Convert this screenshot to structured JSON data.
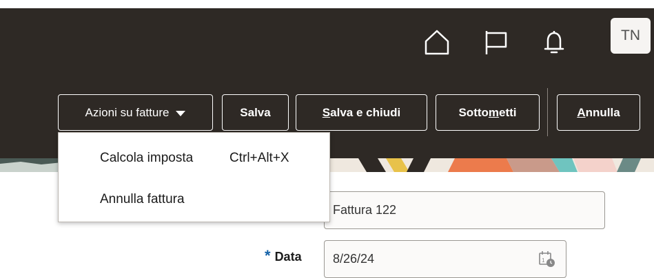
{
  "header": {
    "avatar_initials": "TN",
    "icons": [
      "home-icon",
      "flag-icon",
      "bell-icon"
    ]
  },
  "toolbar": {
    "actions_label": "Azioni su fatture",
    "save_label": "Salva",
    "save_close_prefix": "",
    "save_close_access": "S",
    "save_close_rest": "alva e chiudi",
    "submit_prefix": "Sotto",
    "submit_access": "m",
    "submit_rest": "etti",
    "cancel_prefix": "",
    "cancel_access": "A",
    "cancel_rest": "nnulla"
  },
  "menu": {
    "items": [
      {
        "label": "Calcola imposta",
        "shortcut": "Ctrl+Alt+X"
      },
      {
        "label": "Annulla fattura",
        "shortcut": ""
      }
    ]
  },
  "form": {
    "description_value": "Fattura 122",
    "date_label": "Data",
    "date_required_mark": "*",
    "date_value": "8/26/24"
  },
  "colors": {
    "header_bg": "#2e2925",
    "required": "#1462a8"
  }
}
